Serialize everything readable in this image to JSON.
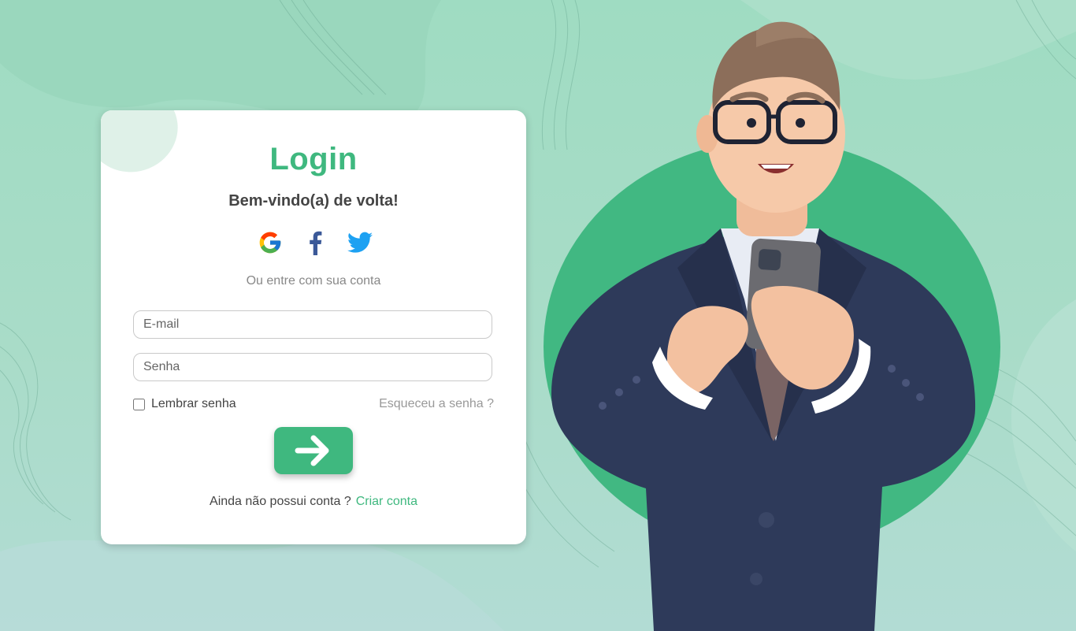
{
  "login": {
    "title": "Login",
    "subtitle": "Bem-vindo(a) de volta!",
    "social": [
      {
        "icon": "google-icon"
      },
      {
        "icon": "facebook-icon"
      },
      {
        "icon": "twitter-icon"
      }
    ],
    "or_text": "Ou entre com sua conta",
    "email_placeholder": "E-mail",
    "password_placeholder": "Senha",
    "remember_label": "Lembrar senha",
    "forgot_label": "Esqueceu a senha ?",
    "submit_icon": "arrow-right-icon",
    "signup_prompt": "Ainda não possui conta ?",
    "signup_link": "Criar conta"
  },
  "colors": {
    "accent": "#3fb87f",
    "background": "#a4dcc4",
    "card": "#ffffff",
    "facebook": "#3b5998",
    "twitter": "#1da1f2"
  }
}
